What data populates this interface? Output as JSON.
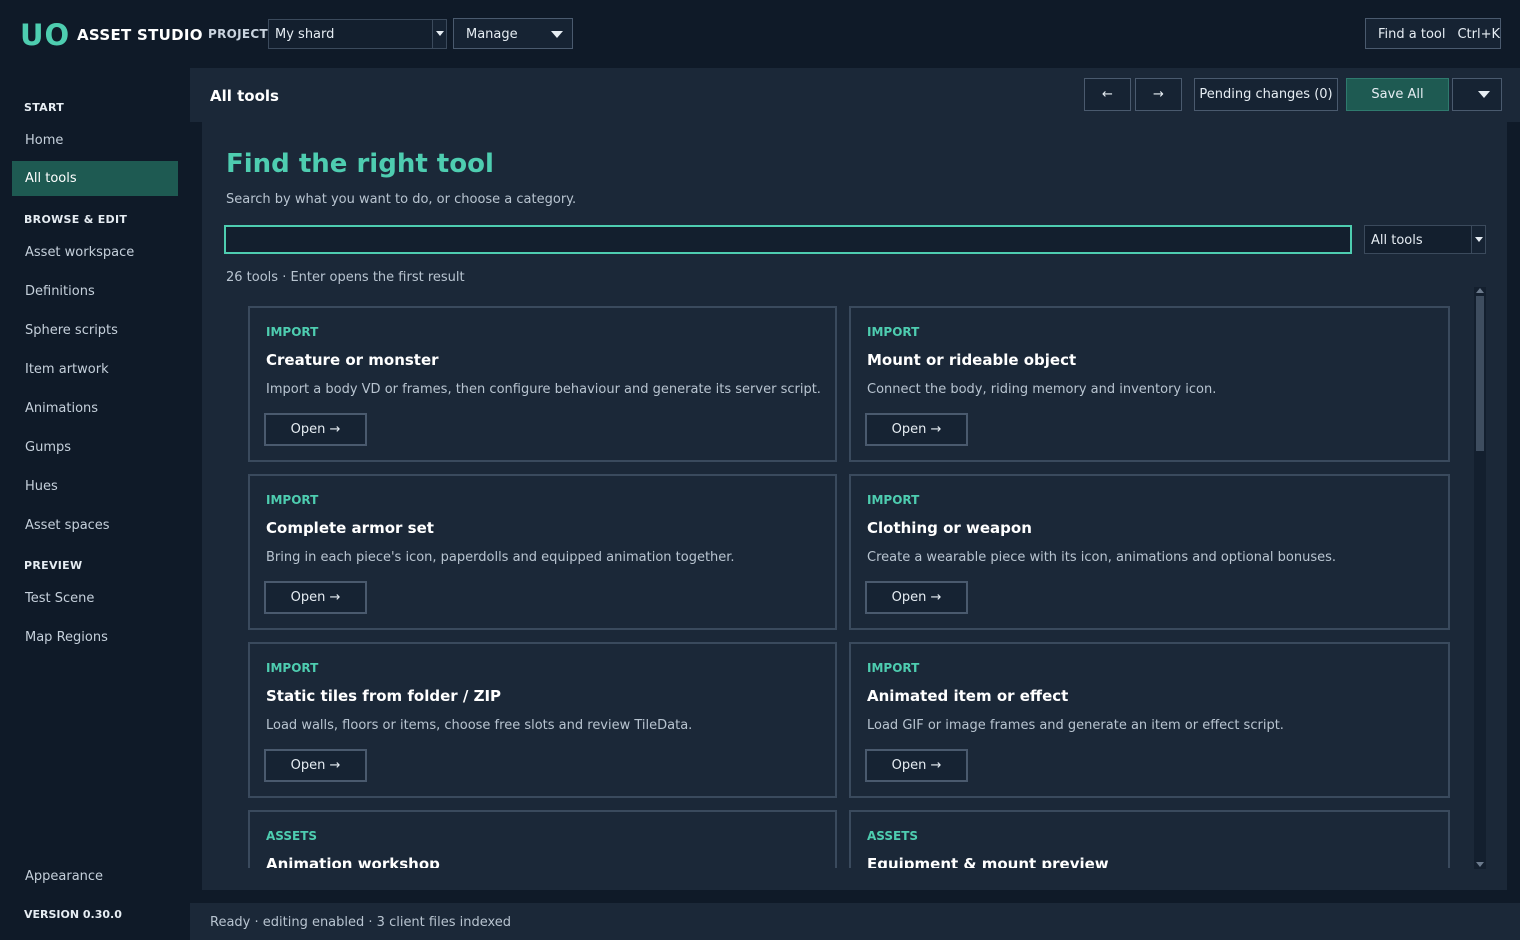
{
  "app": {
    "logo": "UO",
    "name": "ASSET STUDIO",
    "project_label": "PROJECT",
    "project_value": "My shard",
    "manage_label": "Manage",
    "find_tool_label": "Find a tool",
    "find_tool_shortcut": "Ctrl+K"
  },
  "sidebar": {
    "sections": {
      "start": "START",
      "browse": "BROWSE & EDIT",
      "preview": "PREVIEW"
    },
    "items": {
      "home": "Home",
      "all_tools": "All tools",
      "asset_workspace": "Asset workspace",
      "definitions": "Definitions",
      "sphere_scripts": "Sphere scripts",
      "item_artwork": "Item artwork",
      "animations": "Animations",
      "gumps": "Gumps",
      "hues": "Hues",
      "asset_spaces": "Asset spaces",
      "test_scene": "Test Scene",
      "map_regions": "Map Regions",
      "appearance": "Appearance"
    },
    "version": "VERSION 0.30.0"
  },
  "header": {
    "title": "All tools",
    "back": "←",
    "forward": "→",
    "pending": "Pending changes (0)",
    "save_all": "Save All"
  },
  "main": {
    "title": "Find the right tool",
    "subtitle": "Search by what you want to do, or choose a category.",
    "search_value": "",
    "category_value": "All tools",
    "result_count": "26 tools · Enter opens the first result",
    "open_label": "Open →",
    "cards": [
      {
        "category": "IMPORT",
        "title": "Creature or monster",
        "desc": "Import a body VD or frames, then configure behaviour and generate its server script."
      },
      {
        "category": "IMPORT",
        "title": "Mount or rideable object",
        "desc": "Connect the body, riding memory and inventory icon."
      },
      {
        "category": "IMPORT",
        "title": "Complete armor set",
        "desc": "Bring in each piece's icon, paperdolls and equipped animation together."
      },
      {
        "category": "IMPORT",
        "title": "Clothing or weapon",
        "desc": "Create a wearable piece with its icon, animations and optional bonuses."
      },
      {
        "category": "IMPORT",
        "title": "Static tiles from folder / ZIP",
        "desc": "Load walls, floors or items, choose free slots and review TileData."
      },
      {
        "category": "IMPORT",
        "title": "Animated item or effect",
        "desc": "Load GIF or image frames and generate an item or effect script."
      },
      {
        "category": "ASSETS",
        "title": "Animation workshop",
        "desc": ""
      },
      {
        "category": "ASSETS",
        "title": "Equipment & mount preview",
        "desc": ""
      }
    ]
  },
  "status": {
    "text": "Ready · editing enabled · 3 client files indexed"
  },
  "colors": {
    "accent": "#4ecdb0",
    "active_bg": "#1e5a52",
    "background": "#0f1a28",
    "panel": "#1b2838"
  }
}
